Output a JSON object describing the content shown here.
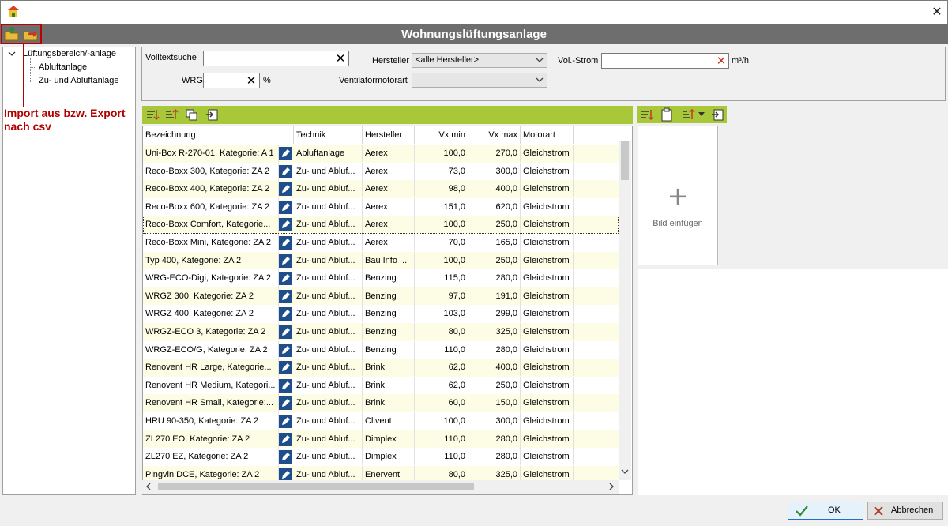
{
  "window": {
    "title": "Wohnungslüftungsanlage",
    "close_glyph": "✕",
    "app_icon": "house-icon"
  },
  "toolbar": {
    "import_icon": "import-folder-icon",
    "export_icon": "export-folder-icon"
  },
  "annotation": {
    "line1": "Import aus bzw. Export",
    "line2": "nach csv",
    "color": "#b00000"
  },
  "tree": {
    "root": "Lüftungsbereich/-anlage",
    "children": [
      "Abluftanlage",
      "Zu- und Abluftanlage"
    ]
  },
  "filters": {
    "volltext_label": "Volltextsuche",
    "volltext_value": "",
    "wrg_label": "WRG",
    "wrg_value": "",
    "wrg_unit": "%",
    "hersteller_label": "Hersteller",
    "hersteller_value": "<alle Hersteller>",
    "motorart_label": "Ventilatormotorart",
    "motorart_value": "",
    "volstrom_label": "Vol.-Strom",
    "volstrom_value": "",
    "volstrom_unit": "m³/h"
  },
  "grid": {
    "columns": [
      "Bezeichnung",
      "Technik",
      "Hersteller",
      "Vx min",
      "Vx max",
      "Motorart"
    ],
    "rows": [
      [
        "Uni-Box R-270-01, Kategorie: A 1",
        "Abluftanlage",
        "Aerex",
        "100,0",
        "270,0",
        "Gleichstrom"
      ],
      [
        "Reco-Boxx 300, Kategorie: ZA 2",
        "Zu- und Abluf...",
        "Aerex",
        "73,0",
        "300,0",
        "Gleichstrom"
      ],
      [
        "Reco-Boxx 400, Kategorie: ZA 2",
        "Zu- und Abluf...",
        "Aerex",
        "98,0",
        "400,0",
        "Gleichstrom"
      ],
      [
        "Reco-Boxx 600, Kategorie: ZA 2",
        "Zu- und Abluf...",
        "Aerex",
        "151,0",
        "620,0",
        "Gleichstrom"
      ],
      [
        "Reco-Boxx Comfort, Kategorie...",
        "Zu- und Abluf...",
        "Aerex",
        "100,0",
        "250,0",
        "Gleichstrom"
      ],
      [
        "Reco-Boxx Mini, Kategorie: ZA 2",
        "Zu- und Abluf...",
        "Aerex",
        "70,0",
        "165,0",
        "Gleichstrom"
      ],
      [
        "Typ 400, Kategorie: ZA 2",
        "Zu- und Abluf...",
        "Bau Info ...",
        "100,0",
        "250,0",
        "Gleichstrom"
      ],
      [
        "WRG-ECO-Digi, Kategorie: ZA 2",
        "Zu- und Abluf...",
        "Benzing",
        "115,0",
        "280,0",
        "Gleichstrom"
      ],
      [
        "WRGZ 300, Kategorie: ZA 2",
        "Zu- und Abluf...",
        "Benzing",
        "97,0",
        "191,0",
        "Gleichstrom"
      ],
      [
        "WRGZ 400, Kategorie: ZA 2",
        "Zu- und Abluf...",
        "Benzing",
        "103,0",
        "299,0",
        "Gleichstrom"
      ],
      [
        "WRGZ-ECO 3, Kategorie: ZA 2",
        "Zu- und Abluf...",
        "Benzing",
        "80,0",
        "325,0",
        "Gleichstrom"
      ],
      [
        "WRGZ-ECO/G, Kategorie: ZA 2",
        "Zu- und Abluf...",
        "Benzing",
        "110,0",
        "280,0",
        "Gleichstrom"
      ],
      [
        "Renovent HR Large, Kategorie...",
        "Zu- und Abluf...",
        "Brink",
        "62,0",
        "400,0",
        "Gleichstrom"
      ],
      [
        "Renovent HR Medium, Kategori...",
        "Zu- und Abluf...",
        "Brink",
        "62,0",
        "250,0",
        "Gleichstrom"
      ],
      [
        "Renovent HR Small, Kategorie:...",
        "Zu- und Abluf...",
        "Brink",
        "60,0",
        "150,0",
        "Gleichstrom"
      ],
      [
        "HRU 90-350, Kategorie: ZA 2",
        "Zu- und Abluf...",
        "Clivent",
        "100,0",
        "300,0",
        "Gleichstrom"
      ],
      [
        "ZL270 EO, Kategorie: ZA 2",
        "Zu- und Abluf...",
        "Dimplex",
        "110,0",
        "280,0",
        "Gleichstrom"
      ],
      [
        "ZL270 EZ, Kategorie: ZA 2",
        "Zu- und Abluf...",
        "Dimplex",
        "110,0",
        "280,0",
        "Gleichstrom"
      ],
      [
        "Pingvin DCE, Kategorie: ZA 2",
        "Zu- und Abluf...",
        "Enervent",
        "80,0",
        "325,0",
        "Gleichstrom"
      ]
    ],
    "selected_row": 4
  },
  "image_panel": {
    "add_glyph": "+",
    "add_label": "Bild einfügen"
  },
  "buttons": {
    "ok_label": "OK",
    "cancel_label": "Abbrechen"
  },
  "colors": {
    "accent_green": "#a8c83a",
    "header_gray": "#6e6e6e",
    "row_alt": "#fdfde6"
  }
}
